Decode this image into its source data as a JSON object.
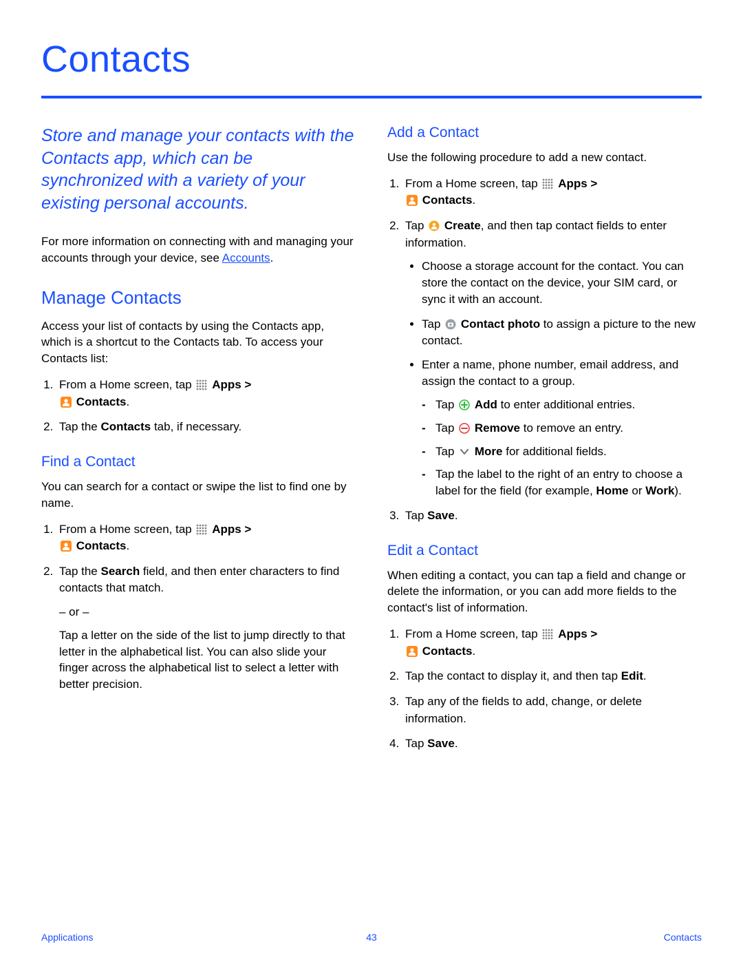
{
  "title": "Contacts",
  "intro": "Store and manage your contacts with the Contacts app, which can be synchronized with a variety of your existing personal accounts.",
  "moreinfo_prefix": "For more information on connecting with and managing your accounts through your device, see ",
  "moreinfo_link": "Accounts",
  "moreinfo_suffix": ".",
  "manage": {
    "heading": "Manage Contacts",
    "desc": "Access your list of contacts by using the Contacts app, which is a shortcut to the Contacts tab. To access your Contacts list:",
    "step1_pre": "From a Home screen, tap ",
    "apps_label": "Apps >",
    "contacts_label": "Contacts",
    "step2_pre": "Tap the ",
    "step2_bold": "Contacts",
    "step2_post": " tab, if necessary."
  },
  "find": {
    "heading": "Find a Contact",
    "desc": "You can search for a contact or swipe the list to find one by name.",
    "step1_pre": "From a Home screen, tap ",
    "step2_pre": "Tap the ",
    "step2_bold": "Search",
    "step2_post": " field, and then enter characters to find contacts that match.",
    "or": "– or –",
    "alt": "Tap a letter on the side of the list to jump directly to that letter in the alphabetical list. You can also slide your finger across the alphabetical list to select a letter with better precision."
  },
  "add": {
    "heading": "Add a Contact",
    "desc": "Use the following procedure to add a new contact.",
    "step1_pre": "From a Home screen, tap ",
    "step2_pre": "Tap ",
    "step2_bold": "Create",
    "step2_post": ", and then tap contact fields to enter information.",
    "b1": "Choose a storage account for the contact. You can store the contact on the device, your SIM card, or sync it with an account.",
    "b2_pre": "Tap ",
    "b2_bold": "Contact photo",
    "b2_post": " to assign a picture to the new contact.",
    "b3": "Enter a name, phone number, email address, and assign the contact to a group.",
    "d1_pre": "Tap ",
    "d1_bold": "Add",
    "d1_post": " to enter additional entries.",
    "d2_pre": "Tap ",
    "d2_bold": "Remove",
    "d2_post": " to remove an entry.",
    "d3_pre": "Tap ",
    "d3_bold": "More",
    "d3_post": " for additional fields.",
    "d4_pre": "Tap the label to the right of an entry to choose a label for the field (for example, ",
    "d4_b1": "Home",
    "d4_mid": " or ",
    "d4_b2": "Work",
    "d4_post": ").",
    "step3_pre": "Tap ",
    "step3_bold": "Save",
    "step3_post": "."
  },
  "edit": {
    "heading": "Edit a Contact",
    "desc": "When editing a contact, you can tap a field and change or delete the information, or you can add more fields to the contact's list of information.",
    "step1_pre": "From a Home screen, tap ",
    "step2_pre": "Tap the contact to display it, and then tap ",
    "step2_bold": "Edit",
    "step2_post": ".",
    "step3": "Tap any of the fields to add, change, or delete information.",
    "step4_pre": "Tap ",
    "step4_bold": "Save",
    "step4_post": "."
  },
  "footer": {
    "left": "Applications",
    "page": "43",
    "right": "Contacts"
  },
  "labels": {
    "apps": "Apps >",
    "contacts": "Contacts",
    "dot": "."
  }
}
